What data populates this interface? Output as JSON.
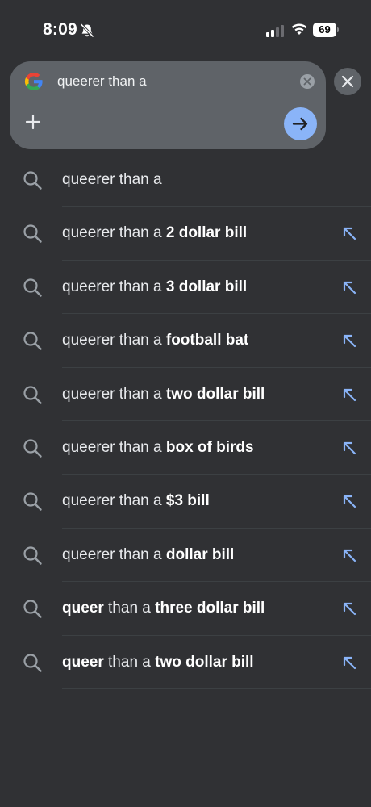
{
  "status_bar": {
    "time": "8:09",
    "battery": "69"
  },
  "search": {
    "query": "queerer than a"
  },
  "colors": {
    "background": "#303134",
    "search_box": "#5f6368",
    "accent": "#8ab4f8"
  },
  "suggestions": [
    {
      "pre": "",
      "normal": "queerer than a",
      "bold": "",
      "fill_arrow": false
    },
    {
      "pre": "",
      "normal": "queerer than a ",
      "bold": "2 dollar bill",
      "fill_arrow": true
    },
    {
      "pre": "",
      "normal": "queerer than a ",
      "bold": "3 dollar bill",
      "fill_arrow": true
    },
    {
      "pre": "",
      "normal": "queerer than a ",
      "bold": "football bat",
      "fill_arrow": true
    },
    {
      "pre": "",
      "normal": "queerer than a ",
      "bold": "two dollar bill",
      "fill_arrow": true
    },
    {
      "pre": "",
      "normal": "queerer than a ",
      "bold": "box of birds",
      "fill_arrow": true
    },
    {
      "pre": "",
      "normal": "queerer than a ",
      "bold": "$3 bill",
      "fill_arrow": true
    },
    {
      "pre": "",
      "normal": "queerer than a ",
      "bold": "dollar bill",
      "fill_arrow": true
    },
    {
      "pre": "queer",
      "normal": " than a ",
      "bold": "three dollar bill",
      "fill_arrow": true
    },
    {
      "pre": "queer",
      "normal": " than a ",
      "bold": "two dollar bill",
      "fill_arrow": true
    }
  ]
}
